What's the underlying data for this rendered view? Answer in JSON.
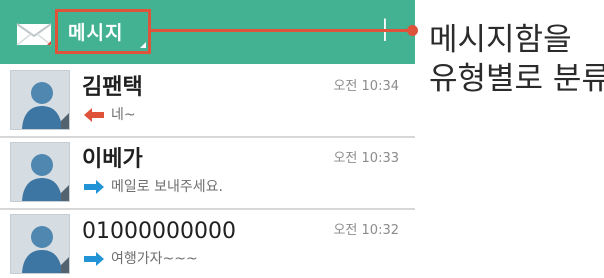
{
  "header": {
    "title": "메시지",
    "add_symbol": "+",
    "icon": "envelope-icon",
    "background_color": "#43b293",
    "highlight_color": "#e0533b"
  },
  "messages": [
    {
      "sender": "김팬택",
      "time": "오전 10:34",
      "preview": "네~",
      "direction": "incoming",
      "arrow_color": "#e0533b"
    },
    {
      "sender": "이베가",
      "time": "오전 10:33",
      "preview": "메일로 보내주세요.",
      "direction": "outgoing",
      "arrow_color": "#2294d6"
    },
    {
      "sender": "01000000000",
      "time": "오전 10:32",
      "preview": "여행가자~~~",
      "direction": "outgoing",
      "arrow_color": "#2294d6"
    }
  ],
  "annotation": {
    "line1": "메시지함을",
    "line2": "유형별로 분류"
  }
}
